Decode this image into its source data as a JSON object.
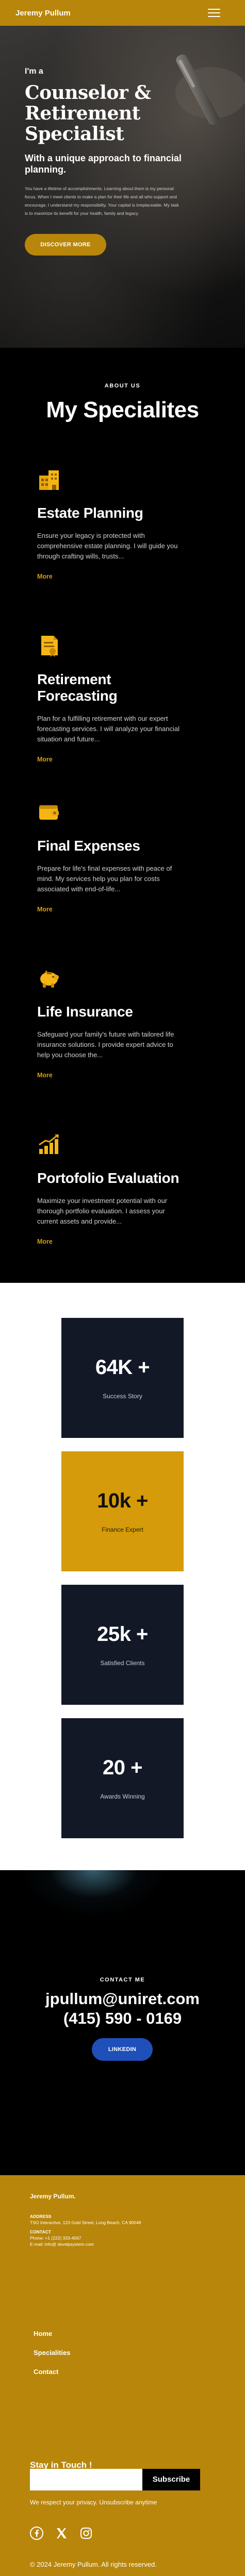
{
  "header": {
    "brand": "Jeremy Pullum"
  },
  "hero": {
    "kicker": "I'm a",
    "title": "Counselor & Retirement Specialist",
    "subtitle": "With a unique approach to financial planning.",
    "body": "You have a lifetime of accomplishments. Learning about them is my personal focus. When I meet clients to make a plan for their life and all who support and encourage, I understand my responsibility. Your capital is irreplaceable. My task is to maximize its benefit for your health, family and legacy.",
    "cta": "DISCOVER MORE"
  },
  "specialties": {
    "kicker": "ABOUT US",
    "heading": "My Specialites",
    "more_label": "More",
    "items": [
      {
        "icon": "building-icon",
        "title": "Estate Planning",
        "text": "Ensure your legacy is protected with comprehensive estate planning. I will guide you through crafting wills, trusts..."
      },
      {
        "icon": "document-icon",
        "title": "Retirement Forecasting",
        "text": "Plan for a fulfilling retirement with our expert forecasting services. I will analyze your financial situation and future..."
      },
      {
        "icon": "wallet-icon",
        "title": "Final Expenses",
        "text": "Prepare for life's final expenses with peace of mind. My services help you plan for costs associated with end-of-life..."
      },
      {
        "icon": "piggy-bank-icon",
        "title": "Life Insurance",
        "text": "Safeguard your family's future with tailored life insurance solutions. I provide expert advice to help you choose the..."
      },
      {
        "icon": "growth-chart-icon",
        "title": "Portofolio Evaluation",
        "text": "Maximize your investment potential with our thorough portfolio evaluation. I assess your current assets and provide..."
      }
    ]
  },
  "stats": [
    {
      "value": "64K +",
      "label": "Success Story"
    },
    {
      "value": "10k +",
      "label": "Finance Expert"
    },
    {
      "value": "25k +",
      "label": "Satisfied Clients"
    },
    {
      "value": "20 +",
      "label": "Awards Winning"
    }
  ],
  "contact": {
    "label": "CONTACT ME",
    "email": "jpullum@uniret.com",
    "phone": "(415) 590 - 0169",
    "linkedin": "LINKEDIN"
  },
  "footer": {
    "brand": "Jeremy Pullum.",
    "address_head": "ADDRESS",
    "address": "TSO Interactive, 123 Gold Street, Long Beach, CA 90048",
    "contact_head": "CONTACT",
    "phone": "Phone: +1 (222) 333-4567",
    "email": "E-mail: info@ develpsystem.com",
    "nav": [
      "Home",
      "Specialities",
      "Contact"
    ],
    "stay": "Stay in Touch !",
    "input_value": "",
    "subscribe": "Subscribe",
    "privacy": "We respect your privacy. Unsubscribe anytime",
    "social_icons": [
      "facebook-icon",
      "x-icon",
      "instagram-icon"
    ],
    "copyright": "© 2024 Jeremy Pullum. All rights reserved."
  },
  "colors": {
    "gold": "#b8860b",
    "gold_accent": "#d79a0b",
    "navy": "#121826",
    "blue": "#1f4fb8"
  }
}
